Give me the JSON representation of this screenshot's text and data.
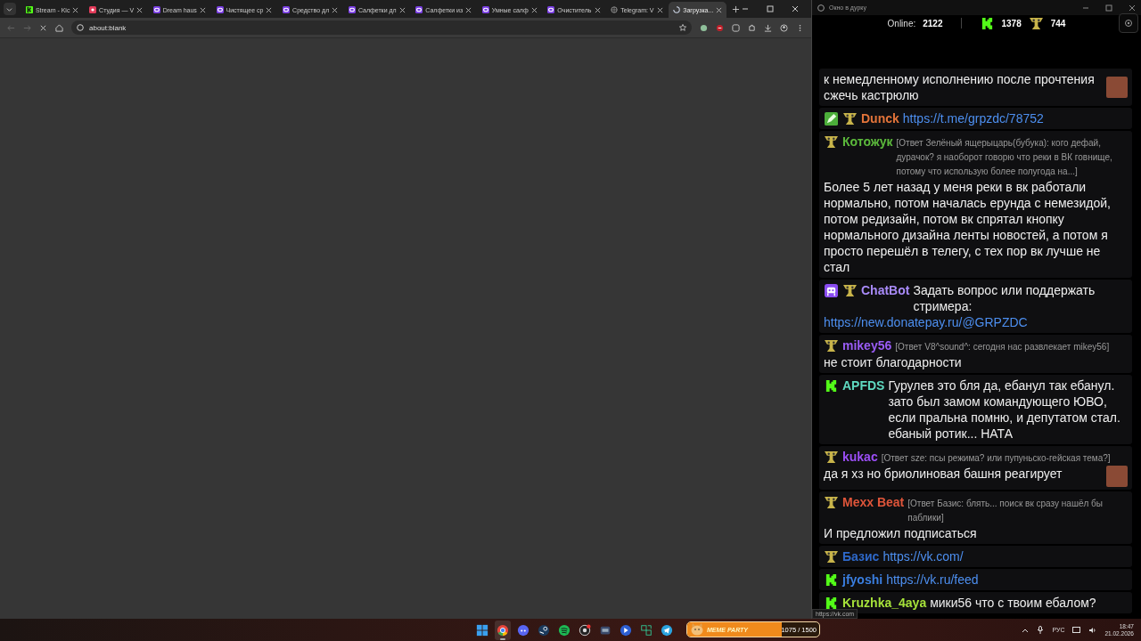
{
  "browser": {
    "tabs": [
      {
        "title": "Stream - Kic",
        "kind": "kick",
        "selected": false
      },
      {
        "title": "Студия — V",
        "kind": "vk",
        "selected": false
      },
      {
        "title": "Dream haus",
        "kind": "ring",
        "selected": false
      },
      {
        "title": "Чистящее ср",
        "kind": "ring",
        "selected": false
      },
      {
        "title": "Средство дл",
        "kind": "ring",
        "selected": false
      },
      {
        "title": "Салфетки дл",
        "kind": "ring",
        "selected": false
      },
      {
        "title": "Салфетки из",
        "kind": "ring",
        "selected": false
      },
      {
        "title": "Умные салф",
        "kind": "ring",
        "selected": false
      },
      {
        "title": "Очиститель",
        "kind": "ring",
        "selected": false
      },
      {
        "title": "Telegram: V",
        "kind": "globe",
        "selected": false
      },
      {
        "title": "Загрузка...",
        "kind": "spinner",
        "selected": true
      }
    ],
    "address": "about:blank"
  },
  "chat": {
    "window_title": "Окно в дурку",
    "online_label": "Online:",
    "online": "2122",
    "kick_count": "1378",
    "trophy_count": "744",
    "messages": [
      {
        "text": "к немедленному исполнению после прочтения сжечь кастрюлю",
        "emote": true
      },
      {
        "name": "Dunck",
        "color": "#e3743a",
        "badges": [
          {
            "kind": "pencil"
          },
          {
            "kind": "trophy"
          }
        ],
        "link": "https://t.me/grpzdc/78752",
        "emote": false
      },
      {
        "name": "Котожук",
        "color": "#5cba3c",
        "badges": [
          {
            "kind": "trophy"
          }
        ],
        "reply": "[Ответ Зелёный ящерыцарь(бубука): кого дефай, дурачок? я наоборот говорю что реки в ВК говнище, потому что использую более полугода на...]",
        "text": "Более 5 лет назад у меня реки в вк работали нормально, потом началась ерунда с немезидой, потом редизайн, потом вк спрятал кнопку нормального дизайна ленты новостей, а потом я просто перешёл в телегу, с тех пор вк лучше не стал",
        "emote": false
      },
      {
        "name": "ChatBot",
        "color": "#a98bfa",
        "badges": [
          {
            "kind": "bot"
          },
          {
            "kind": "trophy"
          }
        ],
        "text": "Задать вопрос или поддержать стримера:",
        "link": "https://new.donatepay.ru/@GRPZDC",
        "emote": false
      },
      {
        "name": "mikey56",
        "color": "#9a5cf5",
        "badges": [
          {
            "kind": "trophy"
          }
        ],
        "reply": "[Ответ V8^sound^: сегодня нас развлекает mikey56]",
        "text": "не стоит благодарности",
        "emote": false
      },
      {
        "name": "APFDS",
        "color": "#5fd9c0",
        "badges": [
          {
            "kind": "kick"
          }
        ],
        "text": "Гурулев это бля да, ебанул так ебанул. зато был замом командующего ЮВО, если пральна помню, и депутатом стал. ебаный ротик... НАТА",
        "emote": false
      },
      {
        "name": "kukac",
        "color": "#9b4ef5",
        "badges": [
          {
            "kind": "trophy"
          }
        ],
        "reply": "[Ответ sze: псы режима? или пупуньско-гейская тема?]",
        "text": "да я хз но бриолиновая башня реагирует",
        "emote": true
      },
      {
        "name": "Mexx Beat",
        "color": "#df553a",
        "badges": [
          {
            "kind": "trophy"
          }
        ],
        "reply": "[Ответ Базис: блять... поиск вк сразу нашёл бы паблики]",
        "text": "И предложил подписаться",
        "emote": false
      },
      {
        "name": "Базис",
        "color": "#2e68c9",
        "badges": [
          {
            "kind": "trophy"
          }
        ],
        "link": "https://vk.com/",
        "emote": false
      },
      {
        "name": "jfyoshi",
        "color": "#3a7ee0",
        "badges": [
          {
            "kind": "kick"
          }
        ],
        "link": "https://vk.ru/feed",
        "emote": false
      },
      {
        "name": "Kruzhka_4aya",
        "color": "#a6e23a",
        "badges": [
          {
            "kind": "kick"
          }
        ],
        "text": "мики56 что с твоим ебалом?",
        "emote": false
      }
    ],
    "status_url": "https://vk.com"
  },
  "taskbar": {
    "apps": [
      {
        "kind": "start",
        "active": false
      },
      {
        "kind": "chrome",
        "active": true
      },
      {
        "kind": "discord",
        "active": false
      },
      {
        "kind": "steam",
        "active": false
      },
      {
        "kind": "spotify",
        "active": false
      },
      {
        "kind": "obs",
        "active": false
      },
      {
        "kind": "app",
        "active": false
      },
      {
        "kind": "player",
        "active": false
      },
      {
        "kind": "tiles",
        "active": false
      },
      {
        "kind": "telegram",
        "active": false
      }
    ],
    "widget": {
      "label": "MEME PARTY",
      "progress": "1075 / 1500",
      "level": 0.717
    },
    "language": "РУС",
    "time": "18:47",
    "date": "21.02.2026"
  }
}
